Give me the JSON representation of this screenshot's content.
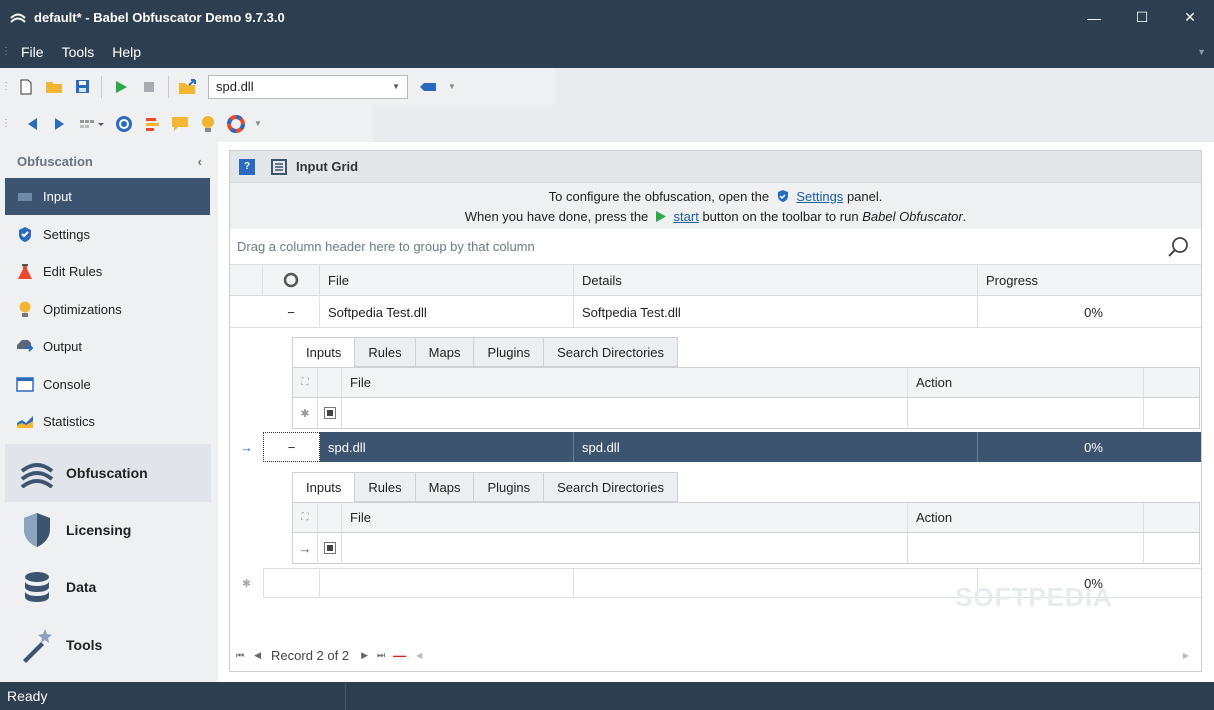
{
  "window": {
    "title": "default* - Babel Obfuscator Demo 9.7.3.0",
    "minimize": "—",
    "maximize": "☐",
    "close": "✕"
  },
  "menu": {
    "items": [
      "File",
      "Tools",
      "Help"
    ]
  },
  "toolbar": {
    "target_combo": "spd.dll"
  },
  "sidebar": {
    "header": "Obfuscation",
    "collapse": "‹",
    "items": [
      {
        "label": "Input",
        "icon": "input-icon",
        "active": true
      },
      {
        "label": "Settings",
        "icon": "settings-shield-icon"
      },
      {
        "label": "Edit Rules",
        "icon": "flask-icon"
      },
      {
        "label": "Optimizations",
        "icon": "lightbulb-icon"
      },
      {
        "label": "Output",
        "icon": "output-icon"
      },
      {
        "label": "Console",
        "icon": "console-icon"
      },
      {
        "label": "Statistics",
        "icon": "statistics-icon"
      }
    ],
    "sections": [
      {
        "label": "Obfuscation",
        "icon": "obfuscation-icon",
        "selected": true
      },
      {
        "label": "Licensing",
        "icon": "shield-icon"
      },
      {
        "label": "Data",
        "icon": "database-icon"
      },
      {
        "label": "Tools",
        "icon": "magic-wand-icon"
      }
    ]
  },
  "panel": {
    "title": "Input Grid",
    "help": "?",
    "info_line1_pre": "To configure the obfuscation, open the",
    "info_line1_link": "Settings",
    "info_line1_post": "panel.",
    "info_line2_pre": "When you have done, press the",
    "info_line2_link": "start",
    "info_line2_post": "button on the toolbar to run",
    "info_line2_app": "Babel Obfuscator",
    "info_line2_end": ".",
    "group_hint": "Drag a column header here to group by that column"
  },
  "grid": {
    "columns": [
      "File",
      "Details",
      "Progress"
    ],
    "rows": [
      {
        "expander": "−",
        "file": "Softpedia Test.dll",
        "details": "Softpedia Test.dll",
        "progress": "0%"
      },
      {
        "expander": "−",
        "file": "spd.dll",
        "details": "spd.dll",
        "progress": "0%",
        "selected": true
      }
    ],
    "new_row_progress": "0%",
    "detail_tabs": [
      "Inputs",
      "Rules",
      "Maps",
      "Plugins",
      "Search Directories"
    ],
    "detail_columns": [
      "File",
      "Action"
    ],
    "new_row_marker": "✱",
    "current_row_marker": "→"
  },
  "navigator": {
    "record_text": "Record 2 of 2"
  },
  "status": {
    "text": "Ready"
  },
  "watermark": "SOFTPEDIA",
  "colors": {
    "titlebar": "#2d3e50",
    "selected_row": "#3d5470",
    "accent_green": "#2aa84a",
    "link": "#1a5ea8"
  }
}
